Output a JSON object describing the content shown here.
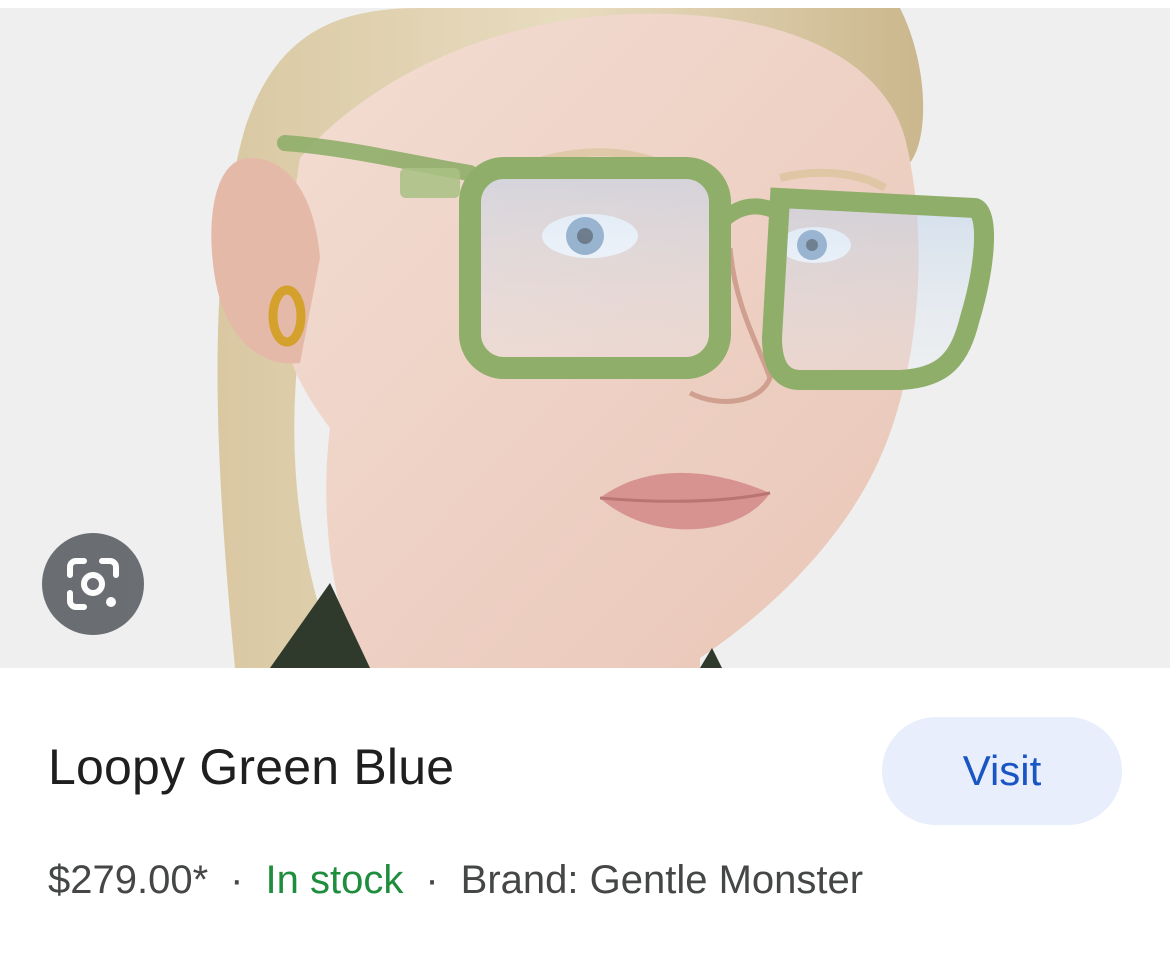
{
  "image": {
    "alt": "",
    "background": "#efefef",
    "frame_color": "#8fae6a",
    "lens_tint": "#d7e6f4"
  },
  "lens_button": {
    "icon": "google-lens-icon"
  },
  "product": {
    "title": "Loopy Green Blue",
    "price": "$279.00*",
    "separator": "·",
    "stock": "In stock",
    "stock_color": "#1e8e3e",
    "brand": "Brand: Gentle Monster"
  },
  "visit_button": {
    "label": "Visit",
    "bg": "#e8eefb",
    "color": "#1a55c4"
  }
}
